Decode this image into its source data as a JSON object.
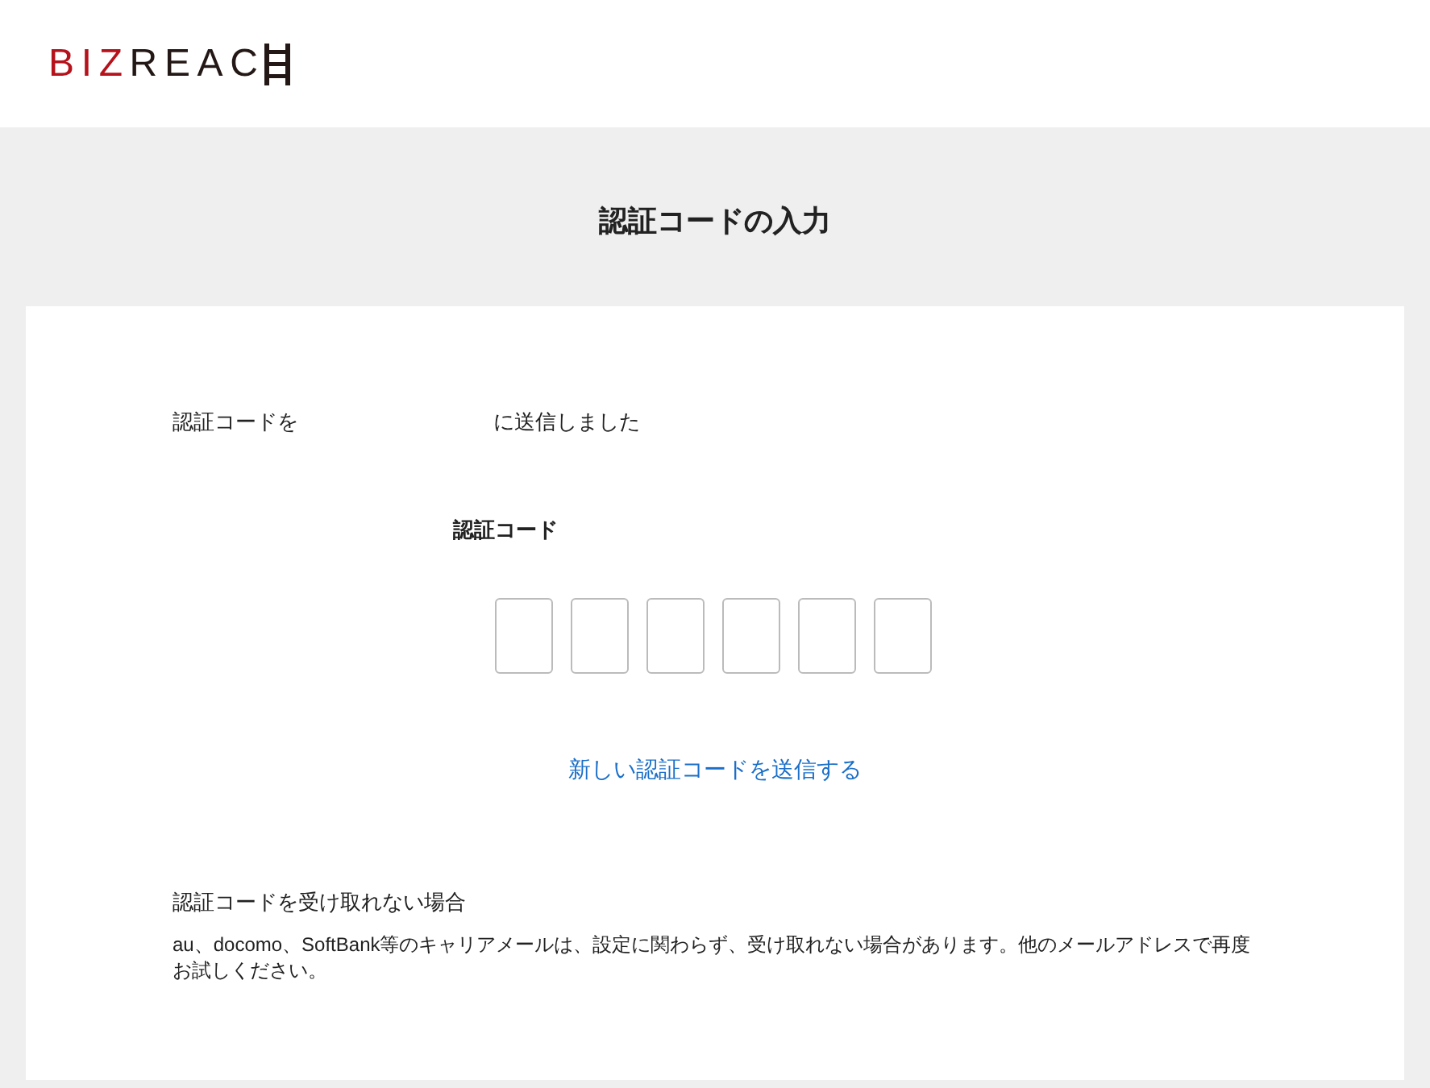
{
  "logo": {
    "accent_part": "BIZ",
    "main_part": "REAC"
  },
  "page_title": "認証コードの入力",
  "sent_message": {
    "before": "認証コードを",
    "after": "に送信しました"
  },
  "code_label": "認証コード",
  "code_fields": [
    {
      "kind": "digit"
    },
    {
      "kind": "digit"
    },
    {
      "kind": "digit"
    },
    {
      "kind": "digit"
    },
    {
      "kind": "digit"
    },
    {
      "kind": "digit"
    }
  ],
  "resend_link": "新しい認証コードを送信する",
  "help": {
    "heading": "認証コードを受け取れない場合",
    "body": "au、docomo、SoftBank等のキャリアメールは、設定に関わらず、受け取れない場合があります。他のメールアドレスで再度お試しください。"
  }
}
